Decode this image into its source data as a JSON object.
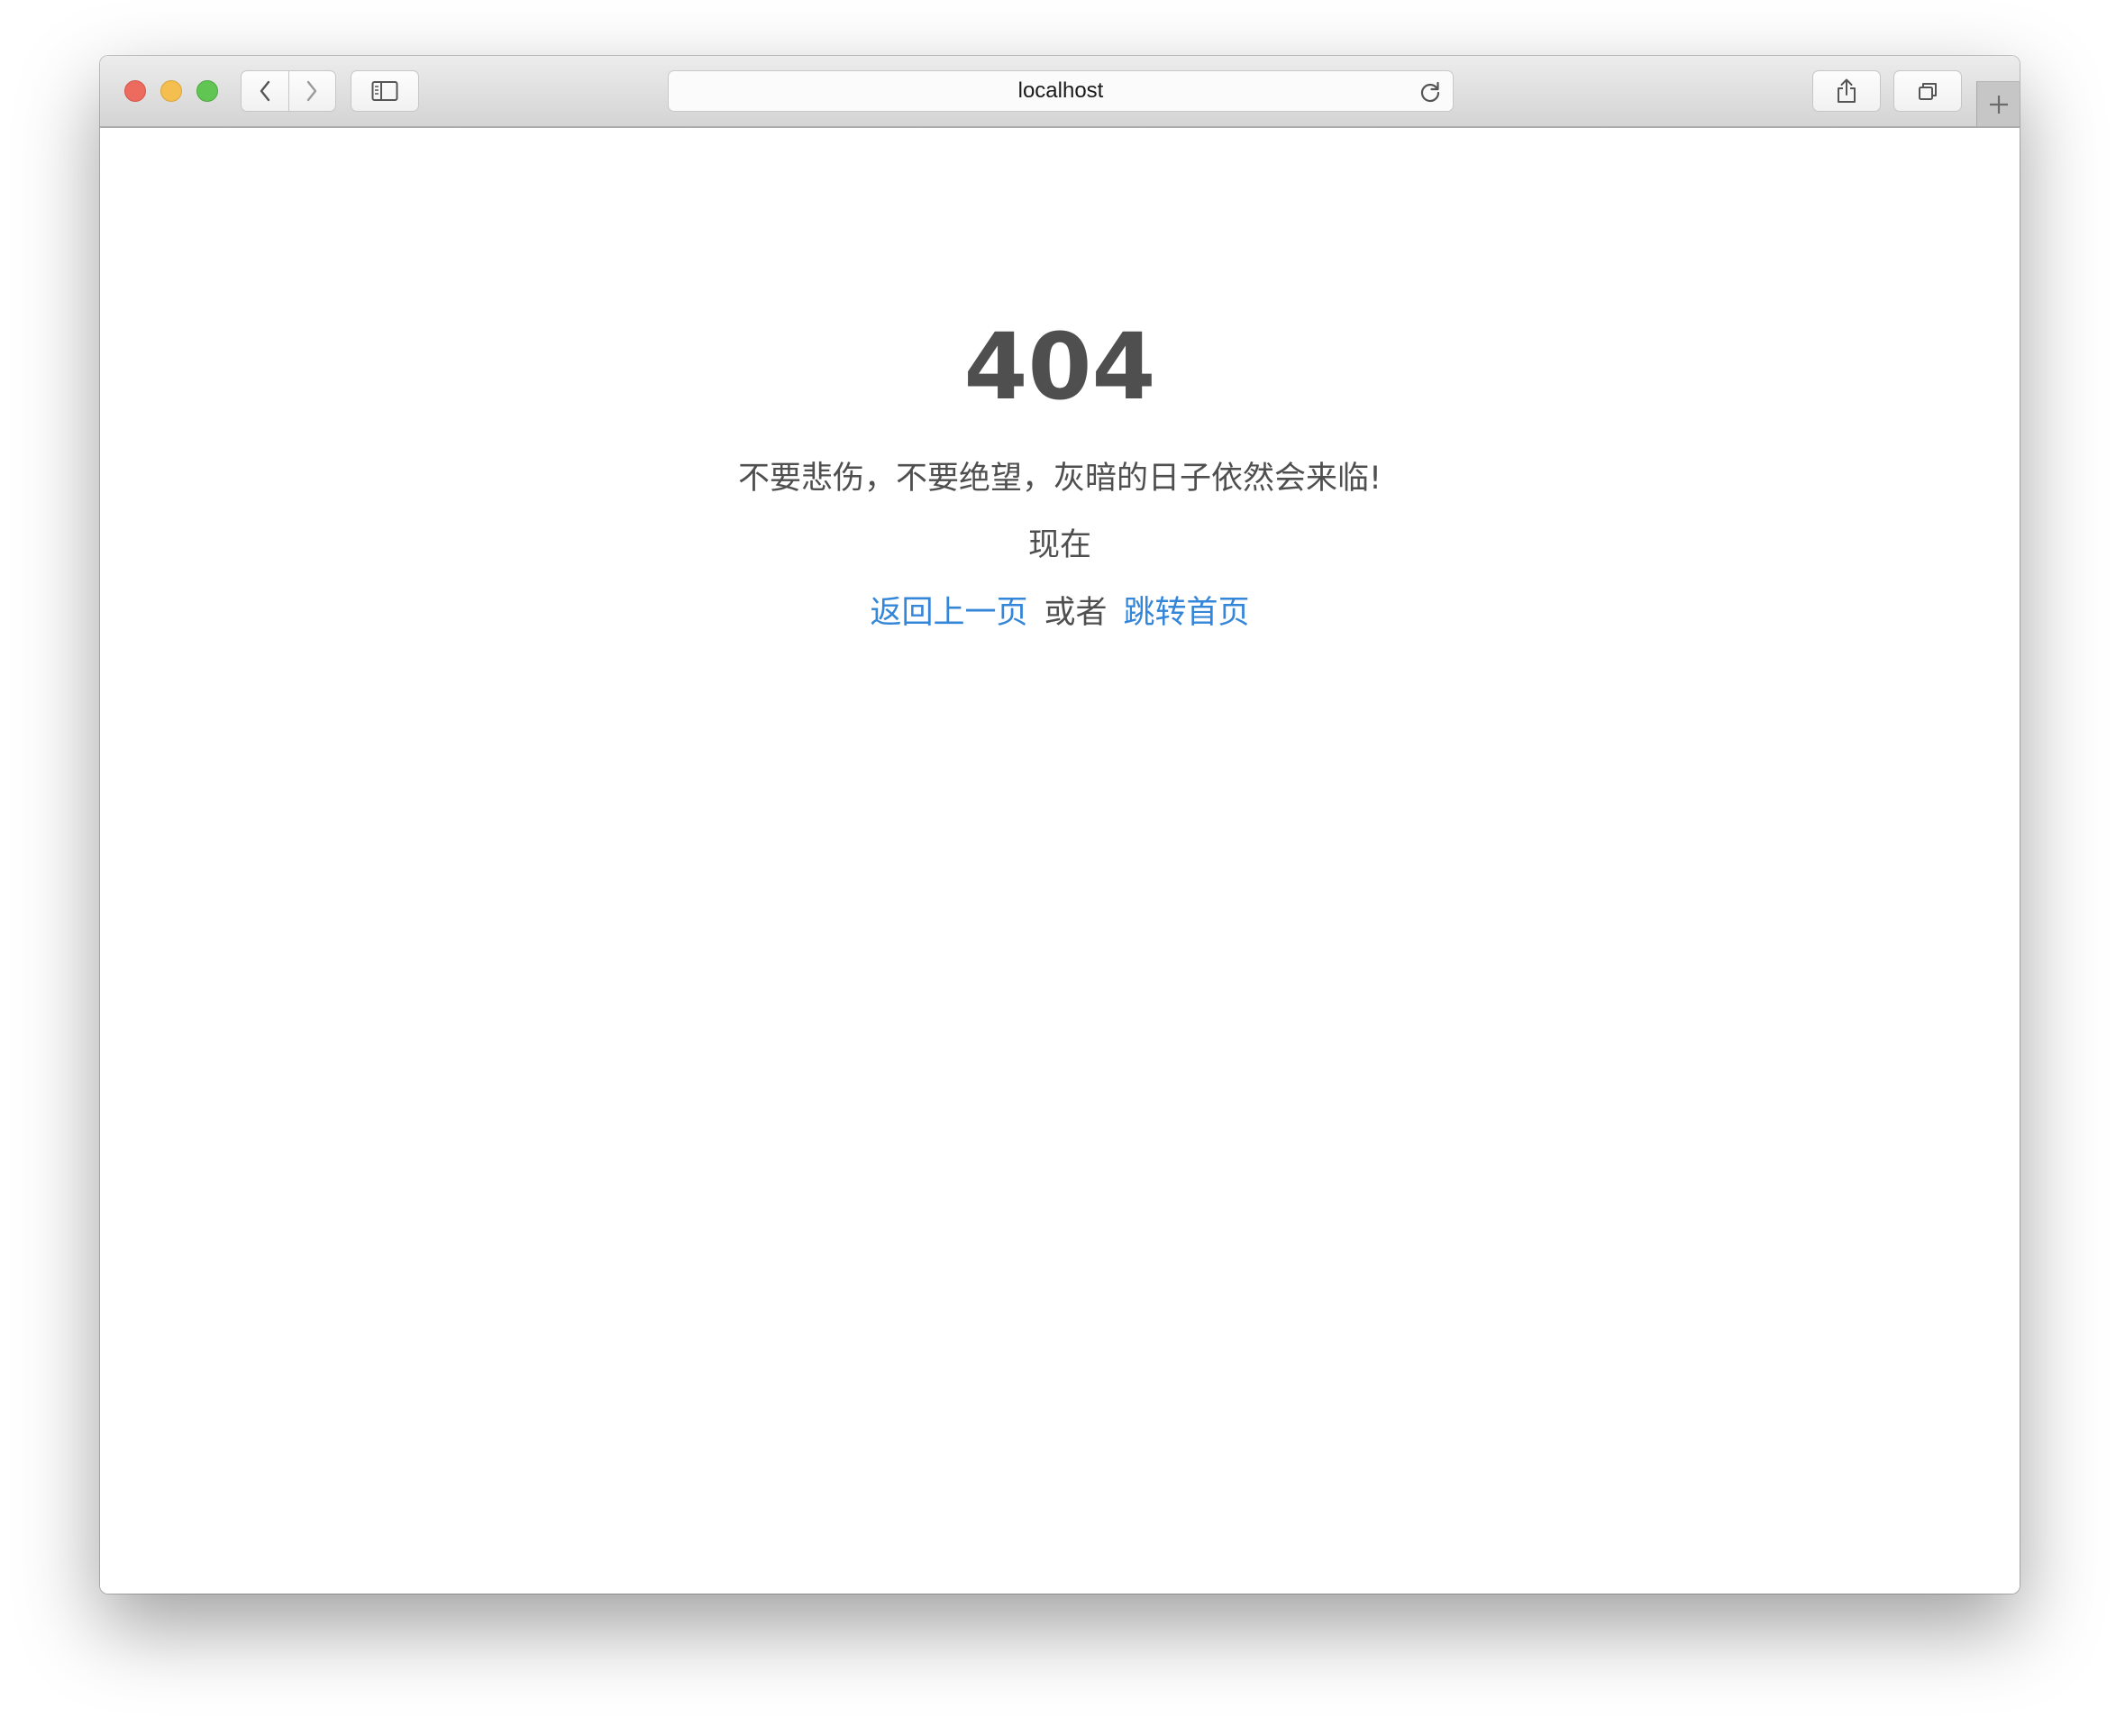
{
  "browser": {
    "address": "localhost",
    "icons": {
      "back": "chevron-left-icon",
      "forward": "chevron-right-icon",
      "sidebar": "sidebar-icon",
      "reload": "reload-icon",
      "share": "share-icon",
      "tabs": "tabs-icon",
      "new_tab": "plus-icon"
    },
    "colors": {
      "close": "#ec6a5e",
      "minimize": "#f4bf4f",
      "maximize": "#61c554"
    }
  },
  "page": {
    "code": "404",
    "message": "不要悲伤，不要绝望，灰暗的日子依然会来临!",
    "now": "现在",
    "back_link": "返回上一页",
    "or_text": "或者",
    "home_link": "跳转首页",
    "link_color": "#3486d8",
    "text_color": "#4f4f4f"
  }
}
